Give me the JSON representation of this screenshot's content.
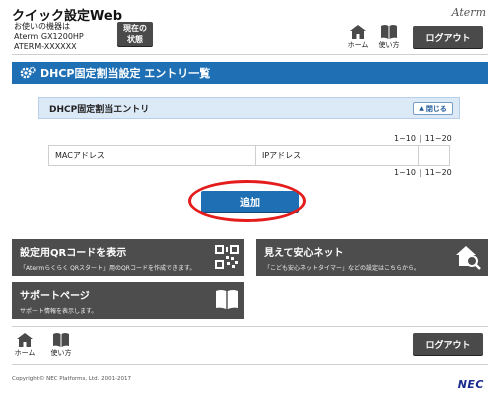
{
  "header": {
    "app_title": "クイック設定Web",
    "device_label": "お使いの機器は",
    "device_model": "Aterm GX1200HP",
    "device_id": "ATERM-XXXXXX",
    "status_button_line1": "現在の",
    "status_button_line2": "状態",
    "brand": "Aterm",
    "home_label": "ホーム",
    "help_label": "使い方",
    "logout_label": "ログアウト"
  },
  "banner": {
    "title": "DHCP固定割当設定 エントリ一覧"
  },
  "panel": {
    "title": "DHCP固定割当エントリ",
    "close_label": "閉じる"
  },
  "pager": {
    "range1": "1~10",
    "range2": "11~20"
  },
  "table": {
    "columns": [
      "MACアドレス",
      "IPアドレス",
      ""
    ]
  },
  "actions": {
    "add_label": "追加"
  },
  "tiles": [
    {
      "title": "設定用QRコードを表示",
      "desc": "「Atermらくらく QRスタート」用のQRコードを作成できます。"
    },
    {
      "title": "見えて安心ネット",
      "desc": "「こども安心ネットタイマー」などの設定はこちらから。"
    },
    {
      "title": "サポートページ",
      "desc": "サポート情報を表示します。"
    }
  ],
  "footer": {
    "home_label": "ホーム",
    "help_label": "使い方",
    "logout_label": "ログアウト",
    "copyright": "Copyright© NEC Platforms, Ltd. 2001-2017",
    "company": "NEC"
  },
  "colors": {
    "accent": "#1f6fb5",
    "dark": "#4a4a4a",
    "highlight": "#e41c1c"
  }
}
